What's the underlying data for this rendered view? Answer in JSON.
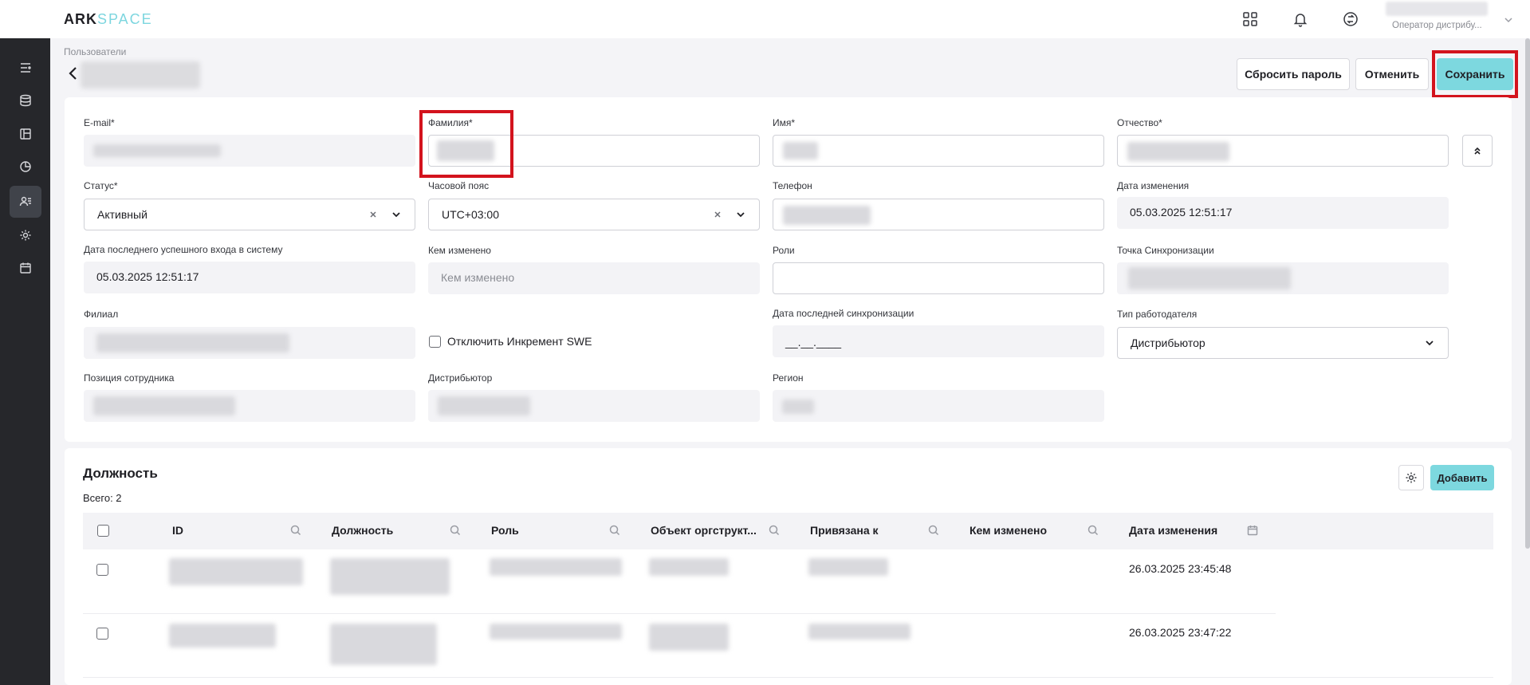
{
  "app": {
    "brand_ark": "ARK",
    "brand_space": "SPACE"
  },
  "topbar": {
    "user_role": "Оператор дистрибу..."
  },
  "header": {
    "breadcrumb": "Пользователи",
    "reset_password_label": "Сбросить пароль",
    "cancel_label": "Отменить",
    "save_label": "Сохранить"
  },
  "form": {
    "email": {
      "label": "E-mail*"
    },
    "last_name": {
      "label": "Фамилия*"
    },
    "first_name": {
      "label": "Имя*"
    },
    "middle_name": {
      "label": "Отчество*"
    },
    "status": {
      "label": "Статус*",
      "value": "Активный"
    },
    "timezone": {
      "label": "Часовой пояс",
      "value": "UTC+03:00"
    },
    "phone": {
      "label": "Телефон"
    },
    "modified_date": {
      "label": "Дата изменения",
      "value": "05.03.2025 12:51:17"
    },
    "last_login": {
      "label": "Дата последнего успешного входа в систему",
      "value": "05.03.2025 12:51:17"
    },
    "modified_by": {
      "label": "Кем изменено",
      "placeholder": "Кем изменено"
    },
    "roles": {
      "label": "Роли"
    },
    "sync_point": {
      "label": "Точка Синхронизации"
    },
    "branch": {
      "label": "Филиал"
    },
    "disable_swe": {
      "label": "Отключить Инкремент SWE"
    },
    "last_sync": {
      "label": "Дата последней синхронизации",
      "value": "__.__.____"
    },
    "employer_type": {
      "label": "Тип работодателя",
      "value": "Дистрибьютор"
    },
    "employee_position": {
      "label": "Позиция сотрудника"
    },
    "distributor": {
      "label": "Дистрибьютор"
    },
    "region": {
      "label": "Регион"
    }
  },
  "positions": {
    "title": "Должность",
    "total": "Всего: 2",
    "add_label": "Добавить",
    "columns": [
      "ID",
      "Должность",
      "Роль",
      "Объект оргструкт...",
      "Привязана к",
      "Кем изменено",
      "Дата изменения"
    ],
    "rows": [
      {
        "modified_date": "26.03.2025 23:45:48"
      },
      {
        "modified_date": "26.03.2025 23:47:22"
      }
    ]
  },
  "colors": {
    "accent": "#7dd8df",
    "sidebar": "#26272b",
    "highlight": "#d3131d"
  },
  "icons": [
    "list-icon",
    "database-icon",
    "layout-icon",
    "chart-icon",
    "users-icon",
    "settings-icon",
    "calendar-icon",
    "apps-icon",
    "bell-icon",
    "sync-icon"
  ]
}
